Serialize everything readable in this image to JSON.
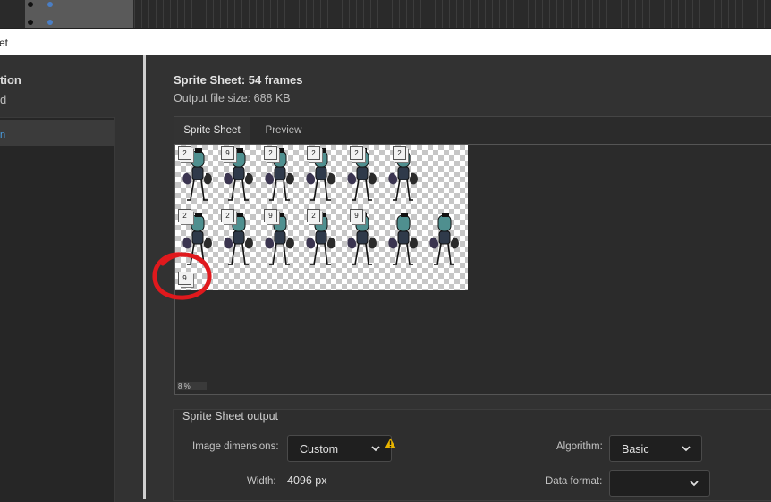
{
  "titlebar": {
    "title_fragment": "et"
  },
  "left_panel": {
    "heading_fragment": "tion",
    "sub_fragment": "d",
    "selected_item_fragment": "n"
  },
  "sheet": {
    "title": "Sprite Sheet: 54 frames",
    "file_size": "Output file size: 688 KB"
  },
  "tabs": [
    {
      "label": "Sprite Sheet",
      "active": true
    },
    {
      "label": "Preview",
      "active": false
    }
  ],
  "preview": {
    "zoom": "8 %",
    "frame_badges": [
      "2",
      "9",
      "2",
      "2",
      "2",
      "2",
      "2",
      "2",
      "9",
      "2",
      "9",
      "9"
    ]
  },
  "output": {
    "section_label": "Sprite Sheet output",
    "image_dimensions_label": "Image dimensions:",
    "image_dimensions_value": "Custom",
    "algorithm_label": "Algorithm:",
    "algorithm_value": "Basic",
    "width_label": "Width:",
    "width_value": "4096 px",
    "data_format_label": "Data format:",
    "data_format_value": ""
  },
  "icons": {
    "warning": "warning-icon",
    "chevron": "chevron-down-icon"
  },
  "colors": {
    "accent": "#4aa0e6",
    "annotation": "#e0191d",
    "warning": "#e8b400"
  }
}
